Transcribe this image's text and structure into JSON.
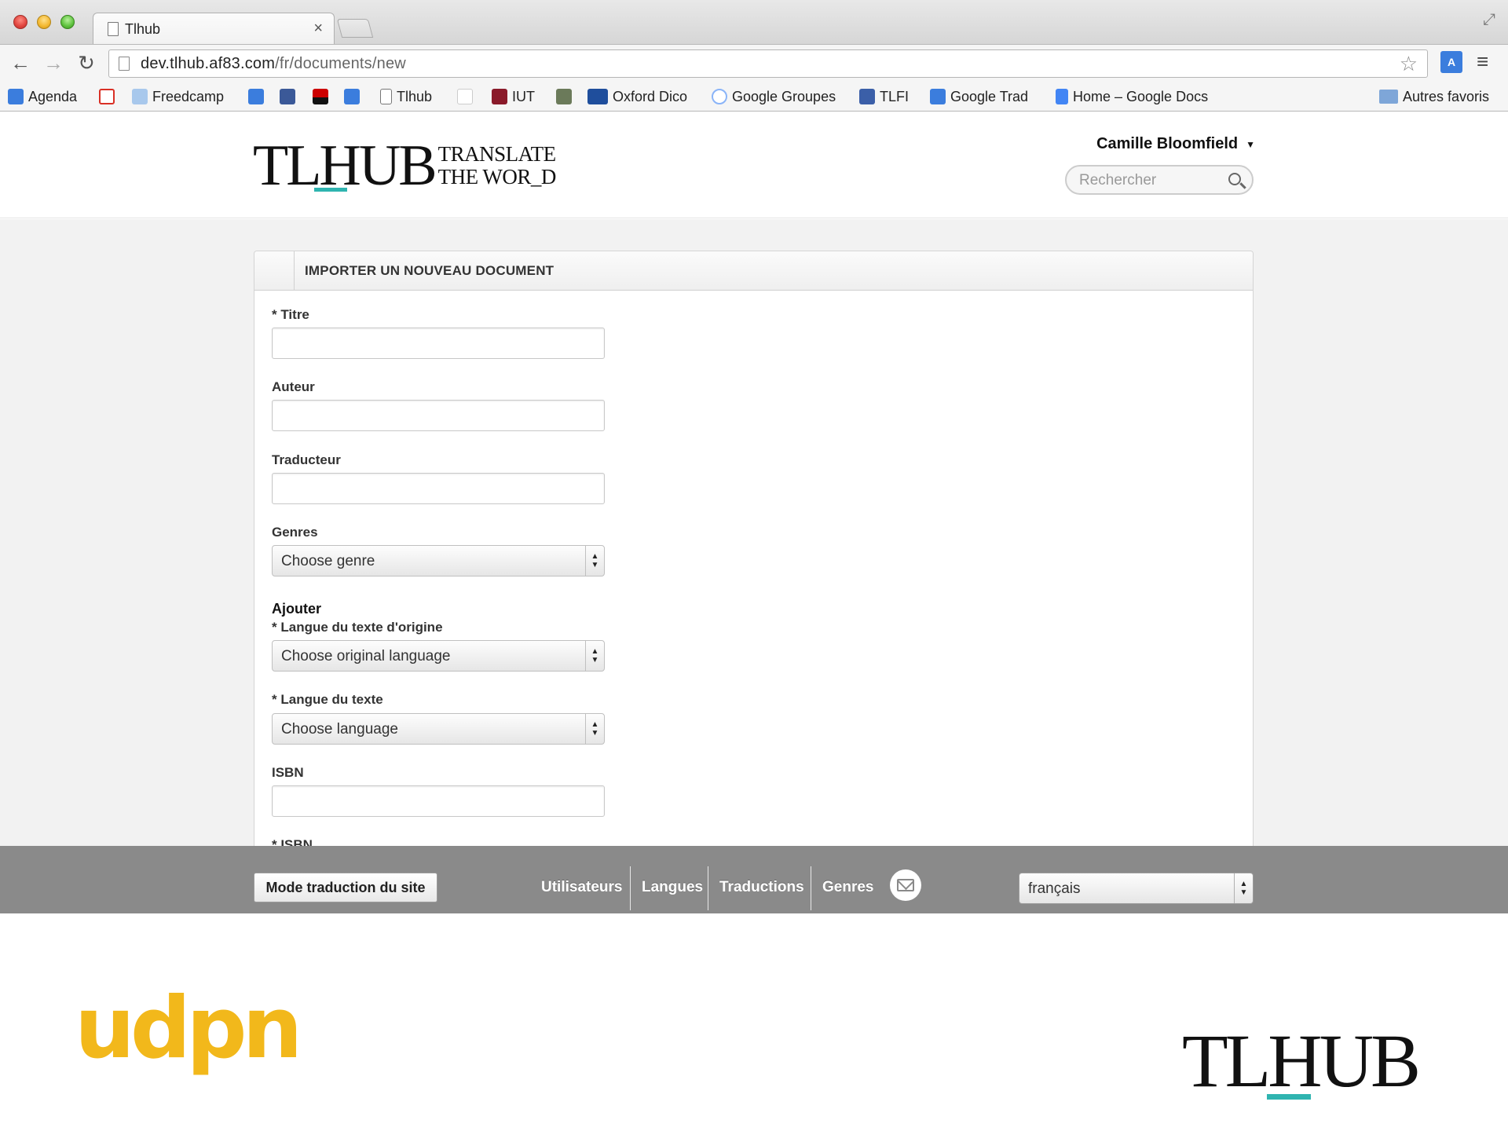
{
  "browser": {
    "tab_title": "Tlhub",
    "tab_close": "×",
    "url_host": "dev.tlhub.af83.com",
    "url_path": "/fr/documents/new",
    "nav": {
      "back": "←",
      "forward": "→",
      "reload": "↻",
      "star": "☆",
      "menu": "≡",
      "fullscreen": "⤢"
    },
    "bookmarks": [
      {
        "label": "Agenda",
        "icon": "google-calendar-icon",
        "color": "#3b7ddd"
      },
      {
        "label": "",
        "icon": "gmail-icon",
        "color": "#d93025"
      },
      {
        "label": "Freedcamp",
        "icon": "freedcamp-icon",
        "color": "#6fa8dc"
      },
      {
        "label": "",
        "icon": "if-icon",
        "color": "#3b7ddd"
      },
      {
        "label": "",
        "icon": "facebook-icon",
        "color": "#3b5998"
      },
      {
        "label": "",
        "icon": "red-black-icon",
        "color": "#cc0000"
      },
      {
        "label": "",
        "icon": "trello-icon",
        "color": "#3b7ddd"
      },
      {
        "label": "Tlhub",
        "icon": "page-icon",
        "color": "#ffffff"
      },
      {
        "label": "",
        "icon": "red-slash-icon",
        "color": "#ffffff"
      },
      {
        "label": "IUT",
        "icon": "iut-icon",
        "color": "#8a1a2a"
      },
      {
        "label": "",
        "icon": "owl-icon",
        "color": "#6b7a5a"
      },
      {
        "label": "Oxford Dico",
        "icon": "odo-icon",
        "color": "#1f4e9c"
      },
      {
        "label": "Google Groupes",
        "icon": "google-groups-icon",
        "color": "#8ab4f8"
      },
      {
        "label": "TLFI",
        "icon": "tlfi-icon",
        "color": "#3b5fa8"
      },
      {
        "label": "Google Trad",
        "icon": "google-translate-icon",
        "color": "#3b7ddd"
      },
      {
        "label": "Home – Google Docs",
        "icon": "google-docs-icon",
        "color": "#4285f4"
      },
      {
        "label": "Autres favoris",
        "icon": "folder-icon",
        "color": "#7ea6d8"
      }
    ]
  },
  "header": {
    "logo_main": "TLHUB",
    "logo_tag_line1": "TRANSLATE",
    "logo_tag_line2": "THE WOR_D",
    "user_name": "Camille Bloomfield",
    "search_placeholder": "Rechercher"
  },
  "form": {
    "panel_title": "IMPORTER UN NOUVEAU DOCUMENT",
    "titre_label": "Titre",
    "auteur_label": "Auteur",
    "traducteur_label": "Traducteur",
    "genres_label": "Genres",
    "genres_value": "Choose genre",
    "ajouter_title": "Ajouter",
    "langue_origine_label": "Langue du texte d'origine",
    "langue_origine_value": "Choose original language",
    "langue_texte_label": "Langue du texte",
    "langue_texte_value": "Choose language",
    "isbn_label": "ISBN",
    "isbn2_label_partial": "* ISBN",
    "required_mark": "*"
  },
  "footer": {
    "mode_button": "Mode traduction du site",
    "links": [
      "Utilisateurs",
      "Langues",
      "Traductions",
      "Genres"
    ],
    "language_value": "français"
  },
  "bottom": {
    "udpn_logo": "udpn",
    "tlhub_logo": "TLHUB"
  },
  "colors": {
    "accent_teal": "#2fb4b0",
    "udpn_yellow": "#f2b81b",
    "footer_gray": "#8a8a8a"
  }
}
